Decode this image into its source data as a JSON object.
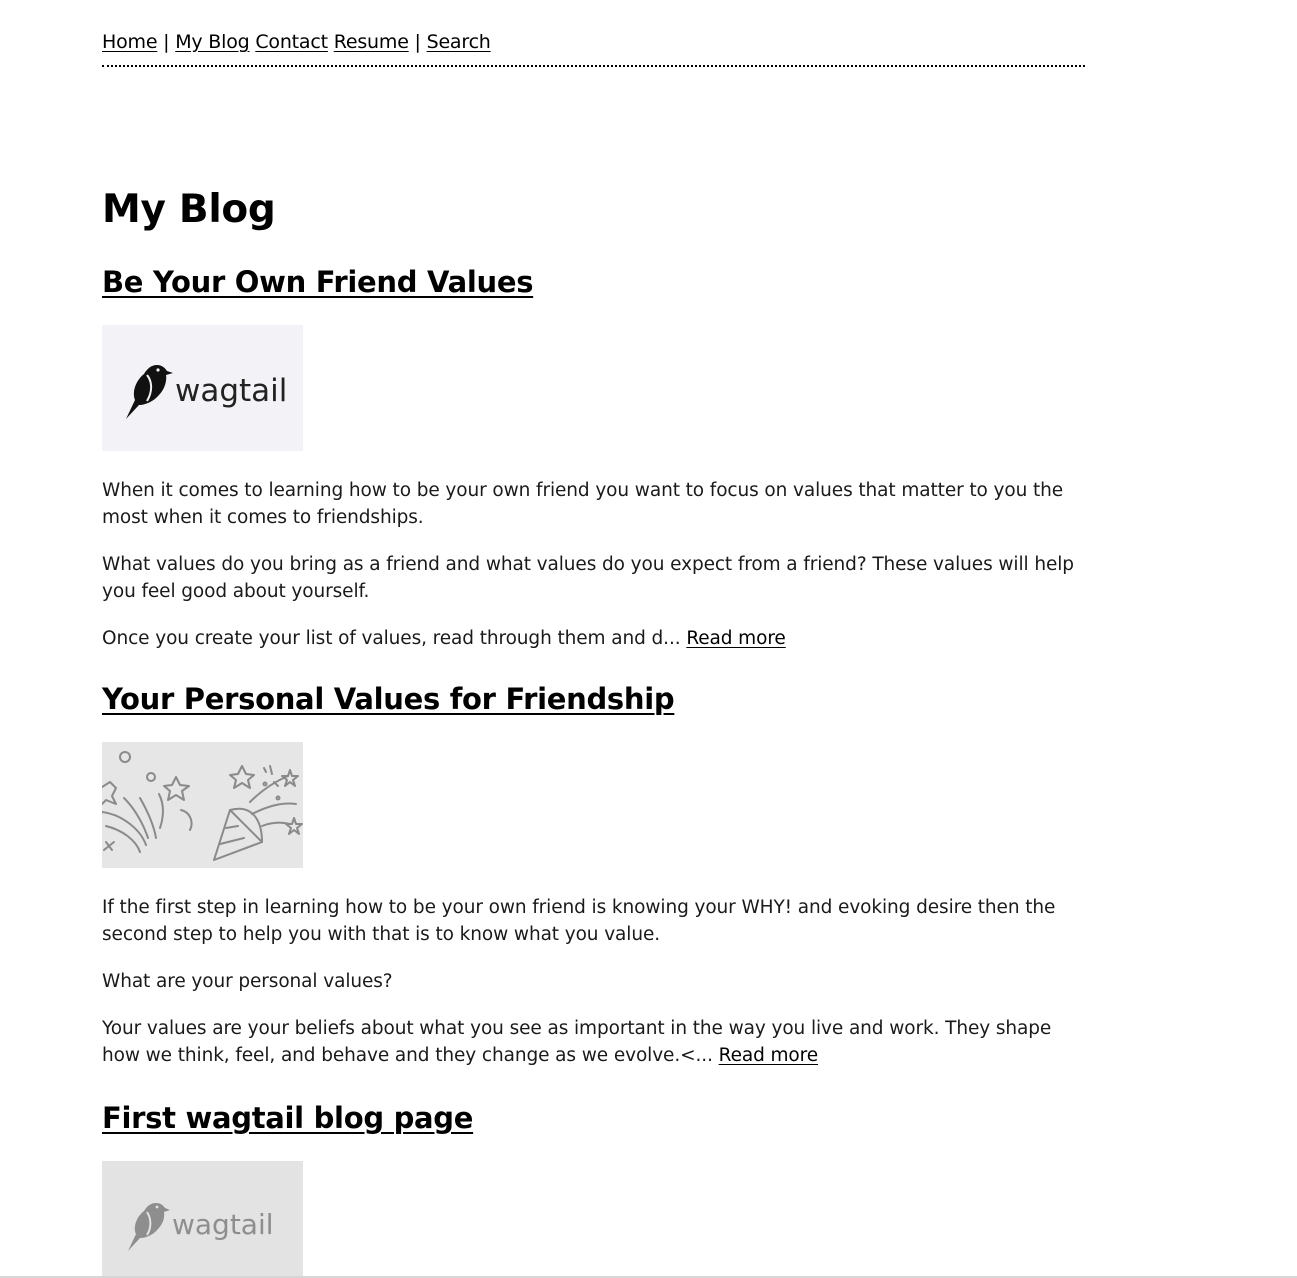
{
  "nav": {
    "home": "Home",
    "sep1": "|",
    "blog": "My Blog",
    "contact": "Contact",
    "resume": "Resume",
    "sep2": "|",
    "search": "Search"
  },
  "page_title": "My Blog",
  "posts": [
    {
      "title": "Be Your Own Friend Values",
      "image_text": "wagtail",
      "paragraphs": [
        "When it comes to learning how to be your own friend you want to focus on values that matter to you the most when it comes to friendships.",
        "What values do you bring as a friend and what values do you expect from a friend? These values will help you feel good about yourself.",
        "Once you create your list of values, read through them and d..."
      ],
      "read_more": "Read more"
    },
    {
      "title": "Your Personal Values for Friendship",
      "paragraphs": [
        "If the first step in learning how to be your own friend is knowing your WHY! and evoking desire then the second step to help you with that is to know what you value.",
        "What are your personal values?",
        "Your values are your beliefs about what you see as important in the way you live and work. They shape how we think, feel, and behave and they change as we evolve.<..."
      ],
      "read_more": "Read more"
    },
    {
      "title": "First wagtail blog page",
      "image_text": "wagtail"
    }
  ],
  "colors": {
    "thumb1_bg": "#f3f2f6",
    "thumb2_bg": "#e6e6e6",
    "thumb3_bg": "#e3e3e3",
    "icon_gray": "#8a8a8a"
  }
}
